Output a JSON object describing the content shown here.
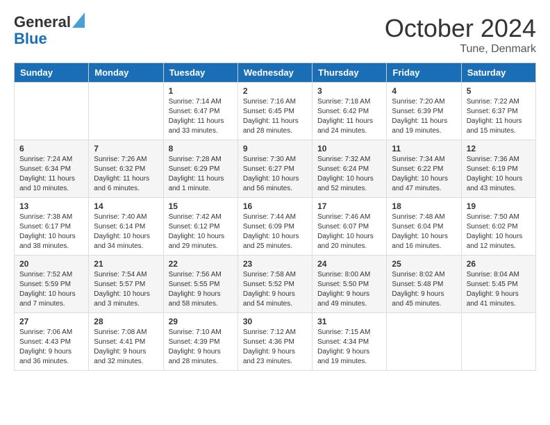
{
  "header": {
    "logo_line1": "General",
    "logo_line2": "Blue",
    "month": "October 2024",
    "location": "Tune, Denmark"
  },
  "days_of_week": [
    "Sunday",
    "Monday",
    "Tuesday",
    "Wednesday",
    "Thursday",
    "Friday",
    "Saturday"
  ],
  "weeks": [
    [
      {
        "num": "",
        "detail": ""
      },
      {
        "num": "",
        "detail": ""
      },
      {
        "num": "1",
        "detail": "Sunrise: 7:14 AM\nSunset: 6:47 PM\nDaylight: 11 hours\nand 33 minutes."
      },
      {
        "num": "2",
        "detail": "Sunrise: 7:16 AM\nSunset: 6:45 PM\nDaylight: 11 hours\nand 28 minutes."
      },
      {
        "num": "3",
        "detail": "Sunrise: 7:18 AM\nSunset: 6:42 PM\nDaylight: 11 hours\nand 24 minutes."
      },
      {
        "num": "4",
        "detail": "Sunrise: 7:20 AM\nSunset: 6:39 PM\nDaylight: 11 hours\nand 19 minutes."
      },
      {
        "num": "5",
        "detail": "Sunrise: 7:22 AM\nSunset: 6:37 PM\nDaylight: 11 hours\nand 15 minutes."
      }
    ],
    [
      {
        "num": "6",
        "detail": "Sunrise: 7:24 AM\nSunset: 6:34 PM\nDaylight: 11 hours\nand 10 minutes."
      },
      {
        "num": "7",
        "detail": "Sunrise: 7:26 AM\nSunset: 6:32 PM\nDaylight: 11 hours\nand 6 minutes."
      },
      {
        "num": "8",
        "detail": "Sunrise: 7:28 AM\nSunset: 6:29 PM\nDaylight: 11 hours\nand 1 minute."
      },
      {
        "num": "9",
        "detail": "Sunrise: 7:30 AM\nSunset: 6:27 PM\nDaylight: 10 hours\nand 56 minutes."
      },
      {
        "num": "10",
        "detail": "Sunrise: 7:32 AM\nSunset: 6:24 PM\nDaylight: 10 hours\nand 52 minutes."
      },
      {
        "num": "11",
        "detail": "Sunrise: 7:34 AM\nSunset: 6:22 PM\nDaylight: 10 hours\nand 47 minutes."
      },
      {
        "num": "12",
        "detail": "Sunrise: 7:36 AM\nSunset: 6:19 PM\nDaylight: 10 hours\nand 43 minutes."
      }
    ],
    [
      {
        "num": "13",
        "detail": "Sunrise: 7:38 AM\nSunset: 6:17 PM\nDaylight: 10 hours\nand 38 minutes."
      },
      {
        "num": "14",
        "detail": "Sunrise: 7:40 AM\nSunset: 6:14 PM\nDaylight: 10 hours\nand 34 minutes."
      },
      {
        "num": "15",
        "detail": "Sunrise: 7:42 AM\nSunset: 6:12 PM\nDaylight: 10 hours\nand 29 minutes."
      },
      {
        "num": "16",
        "detail": "Sunrise: 7:44 AM\nSunset: 6:09 PM\nDaylight: 10 hours\nand 25 minutes."
      },
      {
        "num": "17",
        "detail": "Sunrise: 7:46 AM\nSunset: 6:07 PM\nDaylight: 10 hours\nand 20 minutes."
      },
      {
        "num": "18",
        "detail": "Sunrise: 7:48 AM\nSunset: 6:04 PM\nDaylight: 10 hours\nand 16 minutes."
      },
      {
        "num": "19",
        "detail": "Sunrise: 7:50 AM\nSunset: 6:02 PM\nDaylight: 10 hours\nand 12 minutes."
      }
    ],
    [
      {
        "num": "20",
        "detail": "Sunrise: 7:52 AM\nSunset: 5:59 PM\nDaylight: 10 hours\nand 7 minutes."
      },
      {
        "num": "21",
        "detail": "Sunrise: 7:54 AM\nSunset: 5:57 PM\nDaylight: 10 hours\nand 3 minutes."
      },
      {
        "num": "22",
        "detail": "Sunrise: 7:56 AM\nSunset: 5:55 PM\nDaylight: 9 hours\nand 58 minutes."
      },
      {
        "num": "23",
        "detail": "Sunrise: 7:58 AM\nSunset: 5:52 PM\nDaylight: 9 hours\nand 54 minutes."
      },
      {
        "num": "24",
        "detail": "Sunrise: 8:00 AM\nSunset: 5:50 PM\nDaylight: 9 hours\nand 49 minutes."
      },
      {
        "num": "25",
        "detail": "Sunrise: 8:02 AM\nSunset: 5:48 PM\nDaylight: 9 hours\nand 45 minutes."
      },
      {
        "num": "26",
        "detail": "Sunrise: 8:04 AM\nSunset: 5:45 PM\nDaylight: 9 hours\nand 41 minutes."
      }
    ],
    [
      {
        "num": "27",
        "detail": "Sunrise: 7:06 AM\nSunset: 4:43 PM\nDaylight: 9 hours\nand 36 minutes."
      },
      {
        "num": "28",
        "detail": "Sunrise: 7:08 AM\nSunset: 4:41 PM\nDaylight: 9 hours\nand 32 minutes."
      },
      {
        "num": "29",
        "detail": "Sunrise: 7:10 AM\nSunset: 4:39 PM\nDaylight: 9 hours\nand 28 minutes."
      },
      {
        "num": "30",
        "detail": "Sunrise: 7:12 AM\nSunset: 4:36 PM\nDaylight: 9 hours\nand 23 minutes."
      },
      {
        "num": "31",
        "detail": "Sunrise: 7:15 AM\nSunset: 4:34 PM\nDaylight: 9 hours\nand 19 minutes."
      },
      {
        "num": "",
        "detail": ""
      },
      {
        "num": "",
        "detail": ""
      }
    ]
  ]
}
